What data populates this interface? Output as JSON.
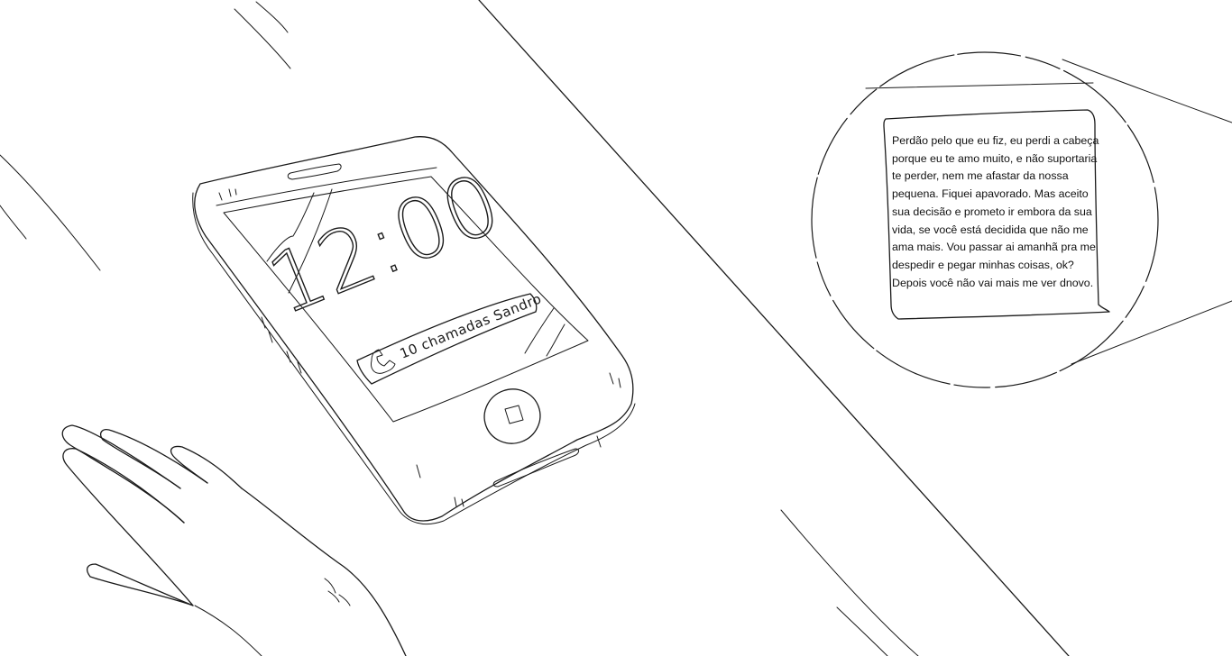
{
  "phone": {
    "clock": "12:00",
    "notification": "10 chamadas Sandro",
    "notification_icon": "phone-icon"
  },
  "message": {
    "lines": [
      "Perdão pelo que eu fiz, eu perdi a cabeça",
      "porque eu te amo muito, e não suportaria",
      "te perder, nem me afastar da nossa",
      "pequena. Fiquei apavorado. Mas aceito",
      "sua decisão e prometo ir embora da sua",
      "vida, se você está decidida que não me",
      "ama mais. Vou passar ai amanhã pra me",
      "despedir e pegar minhas coisas, ok?",
      "Depois você não vai mais me ver dnovo."
    ]
  },
  "colors": {
    "ink": "#1a1a1a",
    "background": "#ffffff"
  }
}
